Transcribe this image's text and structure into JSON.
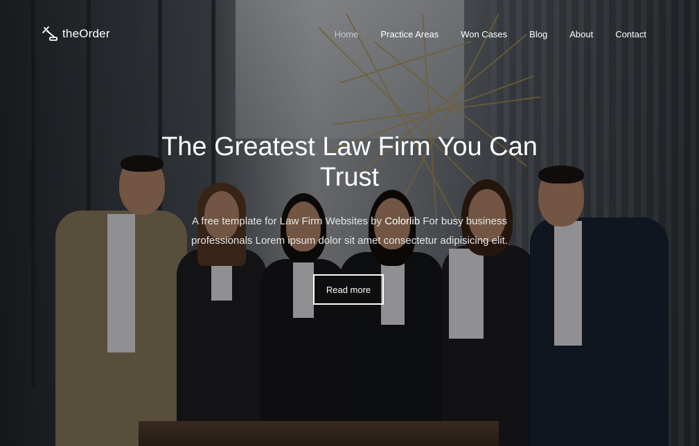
{
  "brand": {
    "name": "theOrder",
    "icon": "gavel-icon"
  },
  "nav": {
    "items": [
      {
        "label": "Home",
        "active": true
      },
      {
        "label": "Practice Areas",
        "active": false
      },
      {
        "label": "Won Cases",
        "active": false
      },
      {
        "label": "Blog",
        "active": false
      },
      {
        "label": "About",
        "active": false
      },
      {
        "label": "Contact",
        "active": false
      }
    ]
  },
  "hero": {
    "title_line1": "The Greatest Law Firm You Can",
    "title_line2": "Trust",
    "subtitle_before": "A free template for Law Firm Websites by ",
    "subtitle_link": "Colorlib",
    "subtitle_after": " For busy business",
    "subtitle_line2": "professionals Lorem ipsum dolor sit amet consectetur adipisicing elit.",
    "cta_label": "Read more"
  },
  "colors": {
    "text": "#ffffff",
    "nav_active": "#c9c9c9",
    "overlay": "rgba(0,0,0,0.38)"
  }
}
